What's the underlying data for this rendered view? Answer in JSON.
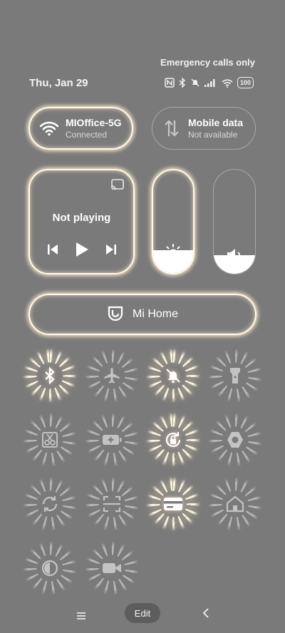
{
  "status": {
    "carrier_text": "Emergency calls only",
    "date": "Thu, Jan 29",
    "battery": "100",
    "icons": [
      "nfc-icon",
      "bluetooth-icon",
      "dnd-icon",
      "signal-icon",
      "wifi-icon",
      "battery-icon"
    ]
  },
  "wifi": {
    "title": "MIOffice-5G",
    "subtitle": "Connected",
    "icon": "wifi-icon",
    "active": true
  },
  "mobile_data": {
    "title": "Mobile data",
    "subtitle": "Not available",
    "icon": "mobile-data-icon",
    "active": false
  },
  "media": {
    "status": "Not playing"
  },
  "brightness": {
    "level": 0.22
  },
  "volume": {
    "level": 0.18
  },
  "mi_home": {
    "label": "Mi Home"
  },
  "tiles": [
    {
      "icon": "bluetooth-icon",
      "active": true
    },
    {
      "icon": "airplane-icon",
      "active": false
    },
    {
      "icon": "bell-off-icon",
      "active": true
    },
    {
      "icon": "flashlight-icon",
      "active": false
    },
    {
      "icon": "screenshot-icon",
      "active": false
    },
    {
      "icon": "battery-saver-icon",
      "active": false
    },
    {
      "icon": "rotation-lock-icon",
      "active": true
    },
    {
      "icon": "camera-shutter-icon",
      "active": false
    },
    {
      "icon": "sync-icon",
      "active": false
    },
    {
      "icon": "scan-icon",
      "active": false
    },
    {
      "icon": "card-icon",
      "active": true
    },
    {
      "icon": "home-icon",
      "active": false
    },
    {
      "icon": "eye-comfort-icon",
      "active": false
    },
    {
      "icon": "screen-record-icon",
      "active": false
    }
  ],
  "nav": {
    "edit_label": "Edit"
  },
  "colors": {
    "background": "#7a7a7a",
    "glow": "#fffaf0"
  }
}
